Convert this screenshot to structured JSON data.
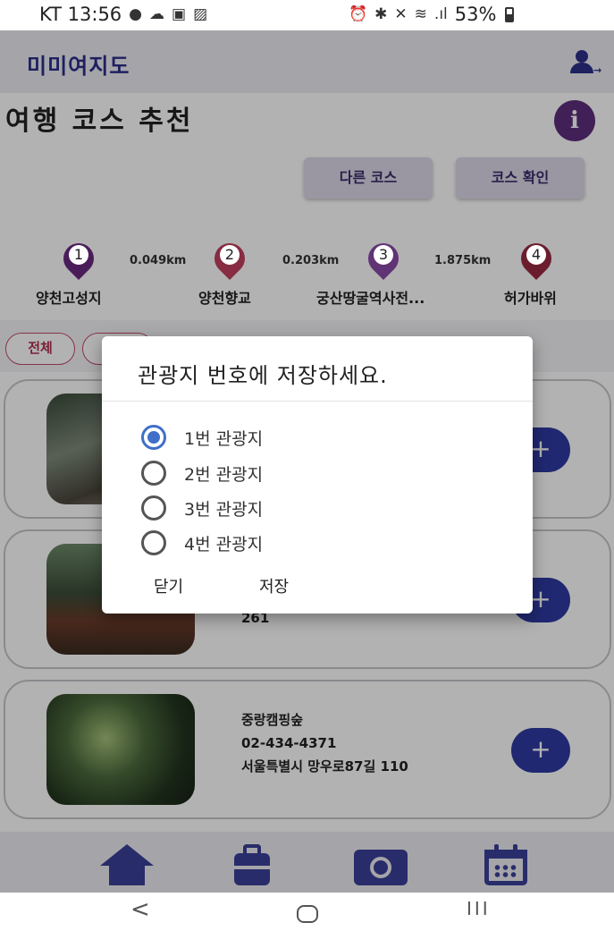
{
  "status_bar": {
    "carrier_time": "KT 13:56",
    "battery": "53%",
    "signal": ".ıl"
  },
  "header": {
    "brand": "미미여지도"
  },
  "page": {
    "title": "여행 코스 추천",
    "info_icon": "i",
    "other_course_label": "다른 코스",
    "check_course_label": "코스 확인"
  },
  "route": {
    "spots": [
      {
        "number": "1",
        "name": "양천고성지",
        "color": "#6a2a82"
      },
      {
        "number": "2",
        "name": "양천향교",
        "color": "#c2405e"
      },
      {
        "number": "3",
        "name": "궁산땅굴역사전...",
        "color": "#8a4aa6"
      },
      {
        "number": "4",
        "name": "허가바위",
        "color": "#9a2a42"
      }
    ],
    "distances": [
      "0.049km",
      "0.203km",
      "1.875km"
    ]
  },
  "filters": {
    "all_label": "전체"
  },
  "cards": [
    {
      "lines": []
    },
    {
      "lines": [
        "261"
      ]
    },
    {
      "lines": [
        "중랑캠핑숲",
        "02-434-4371",
        "서울특별시 망우로87길 110"
      ]
    }
  ],
  "add_icon": "+",
  "dialog": {
    "title": "관광지 번호에 저장하세요.",
    "options": [
      "1번 관광지",
      "2번 관광지",
      "3번 관광지",
      "4번 관광지"
    ],
    "selected_index": 0,
    "close_label": "닫기",
    "save_label": "저장"
  },
  "nav": {
    "back_glyph": "<",
    "recent_glyph": "III"
  },
  "colors": {
    "accent": "#2f3aa3",
    "brand": "#2b2f8a",
    "radio_selected": "#3f6fc8"
  }
}
